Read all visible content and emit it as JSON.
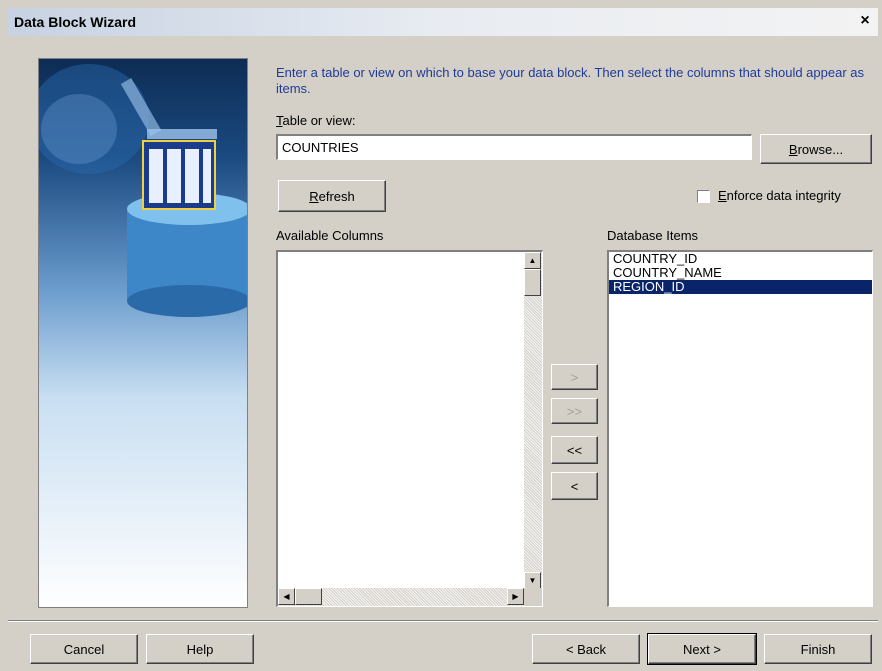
{
  "window": {
    "title": "Data Block Wizard",
    "close_glyph": "×"
  },
  "instructions": "Enter a table or view on which to base your data block.  Then select the columns that should appear as items.",
  "table_or_view": {
    "label_mnemonic": "T",
    "label_rest": "able or view:",
    "value": "COUNTRIES"
  },
  "buttons": {
    "browse": {
      "mnemonic": "B",
      "rest": "rowse..."
    },
    "refresh": {
      "mnemonic": "R",
      "rest": "efresh"
    },
    "move_right": ">",
    "move_all_right": ">>",
    "move_all_left": "<<",
    "move_left": "<",
    "cancel": "Cancel",
    "help": "Help",
    "back": "< Back",
    "next": "Next >",
    "finish": "Finish"
  },
  "enforce_integrity": {
    "mnemonic": "E",
    "rest": "nforce data integrity",
    "checked": false
  },
  "available_columns": {
    "label": "Available Columns",
    "items": []
  },
  "database_items": {
    "label": "Database Items",
    "items": [
      "COUNTRY_ID",
      "COUNTRY_NAME",
      "REGION_ID"
    ],
    "selected_index": 2
  },
  "icons": [
    "close-icon",
    "scroll-up-arrow-icon",
    "scroll-down-arrow-icon",
    "scroll-left-arrow-icon",
    "scroll-right-arrow-icon",
    "database-graphic"
  ]
}
